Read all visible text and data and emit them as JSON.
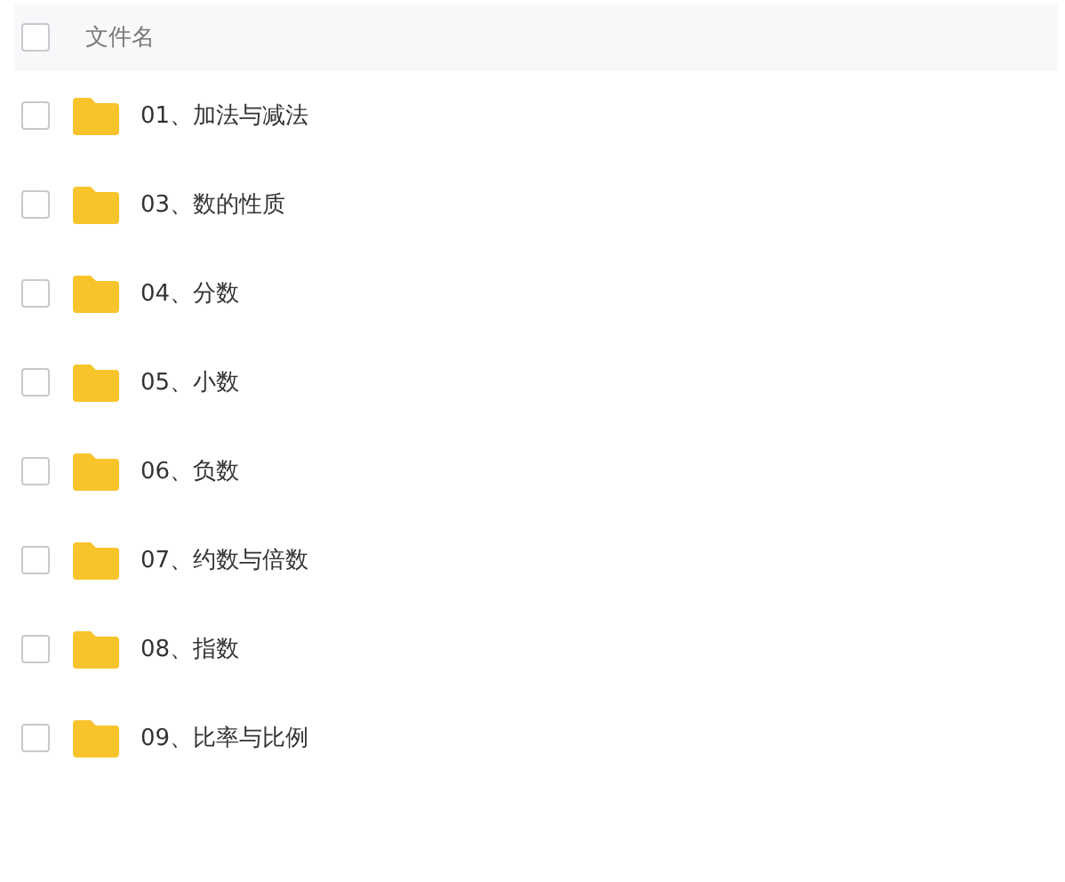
{
  "header": {
    "label": "文件名",
    "checked": false
  },
  "files": [
    {
      "name": "01、加法与减法",
      "checked": false
    },
    {
      "name": "03、数的性质",
      "checked": false
    },
    {
      "name": "04、分数",
      "checked": false
    },
    {
      "name": "05、小数",
      "checked": false
    },
    {
      "name": "06、负数",
      "checked": false
    },
    {
      "name": "07、约数与倍数",
      "checked": false
    },
    {
      "name": "08、指数",
      "checked": false
    },
    {
      "name": "09、比率与比例",
      "checked": false
    }
  ]
}
